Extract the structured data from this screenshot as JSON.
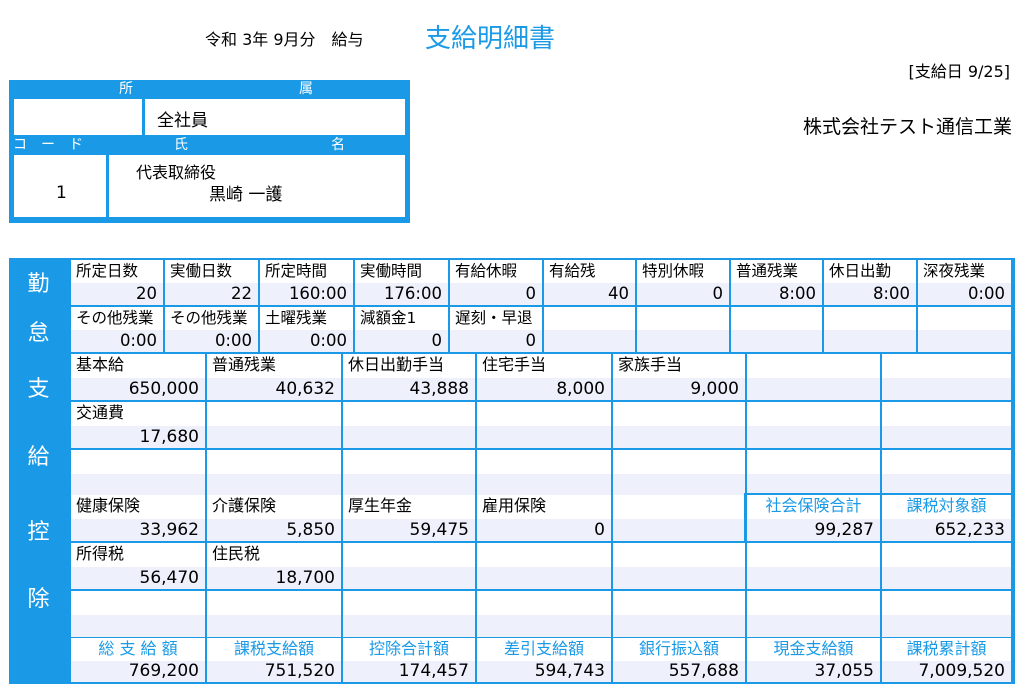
{
  "header": {
    "period": "令和 3年 9月分　給与",
    "title": "支給明細書",
    "payday": "[支給日 9/25]",
    "company": "株式会社テスト通信工業"
  },
  "employee": {
    "dept_label_1": "所",
    "dept_label_2": "属",
    "dept": "全社員",
    "code_label": "コ　ー　ド",
    "name_label_1": "氏",
    "name_label_2": "名",
    "code": "1",
    "role": "代表取締役",
    "name": "黒崎 一護"
  },
  "categories": {
    "attendance": [
      "勤",
      "怠"
    ],
    "payment": [
      "支",
      "給"
    ],
    "deduction": [
      "控",
      "除"
    ]
  },
  "attendance": {
    "row1": [
      {
        "label": "所定日数",
        "value": "20"
      },
      {
        "label": "実働日数",
        "value": "22"
      },
      {
        "label": "所定時間",
        "value": "160:00"
      },
      {
        "label": "実働時間",
        "value": "176:00"
      },
      {
        "label": "有給休暇",
        "value": "0"
      },
      {
        "label": "有給残",
        "value": "40"
      },
      {
        "label": "特別休暇",
        "value": "0"
      },
      {
        "label": "普通残業",
        "value": "8:00"
      },
      {
        "label": "休日出勤",
        "value": "8:00"
      },
      {
        "label": "深夜残業",
        "value": "0:00"
      }
    ],
    "row2": [
      {
        "label": "その他残業",
        "value": "0:00"
      },
      {
        "label": "その他残業",
        "value": "0:00"
      },
      {
        "label": "土曜残業",
        "value": "0:00"
      },
      {
        "label": "減額金1",
        "value": "0"
      },
      {
        "label": "遅刻・早退",
        "value": "0"
      },
      {
        "label": "",
        "value": ""
      },
      {
        "label": "",
        "value": ""
      },
      {
        "label": "",
        "value": ""
      },
      {
        "label": "",
        "value": ""
      },
      {
        "label": "",
        "value": ""
      }
    ]
  },
  "payment": {
    "row1": [
      {
        "label": "基本給",
        "value": "650,000"
      },
      {
        "label": "普通残業",
        "value": "40,632"
      },
      {
        "label": "休日出勤手当",
        "value": "43,888"
      },
      {
        "label": "住宅手当",
        "value": "8,000"
      },
      {
        "label": "家族手当",
        "value": "9,000"
      },
      {
        "label": "",
        "value": ""
      },
      {
        "label": "",
        "value": ""
      }
    ],
    "row2": [
      {
        "label": "交通費",
        "value": "17,680"
      },
      {
        "label": "",
        "value": ""
      },
      {
        "label": "",
        "value": ""
      },
      {
        "label": "",
        "value": ""
      },
      {
        "label": "",
        "value": ""
      },
      {
        "label": "",
        "value": ""
      },
      {
        "label": "",
        "value": ""
      }
    ]
  },
  "deduction": {
    "row1": [
      {
        "label": "健康保険",
        "value": "33,962"
      },
      {
        "label": "介護保険",
        "value": "5,850"
      },
      {
        "label": "厚生年金",
        "value": "59,475"
      },
      {
        "label": "雇用保険",
        "value": "0"
      },
      {
        "label": "",
        "value": ""
      }
    ],
    "row1_summary": [
      {
        "label": "社会保険合計",
        "value": "99,287"
      },
      {
        "label": "課税対象額",
        "value": "652,233"
      }
    ],
    "row2": [
      {
        "label": "所得税",
        "value": "56,470"
      },
      {
        "label": "住民税",
        "value": "18,700"
      },
      {
        "label": "",
        "value": ""
      },
      {
        "label": "",
        "value": ""
      },
      {
        "label": "",
        "value": ""
      },
      {
        "label": "",
        "value": ""
      },
      {
        "label": "",
        "value": ""
      }
    ]
  },
  "totals": [
    {
      "label": "総 支 給 額",
      "value": "769,200"
    },
    {
      "label": "課税支給額",
      "value": "751,520"
    },
    {
      "label": "控除合計額",
      "value": "174,457"
    },
    {
      "label": "差引支給額",
      "value": "594,743"
    },
    {
      "label": "銀行振込額",
      "value": "557,688"
    },
    {
      "label": "現金支給額",
      "value": "37,055"
    },
    {
      "label": "課税累計額",
      "value": "7,009,520"
    }
  ]
}
